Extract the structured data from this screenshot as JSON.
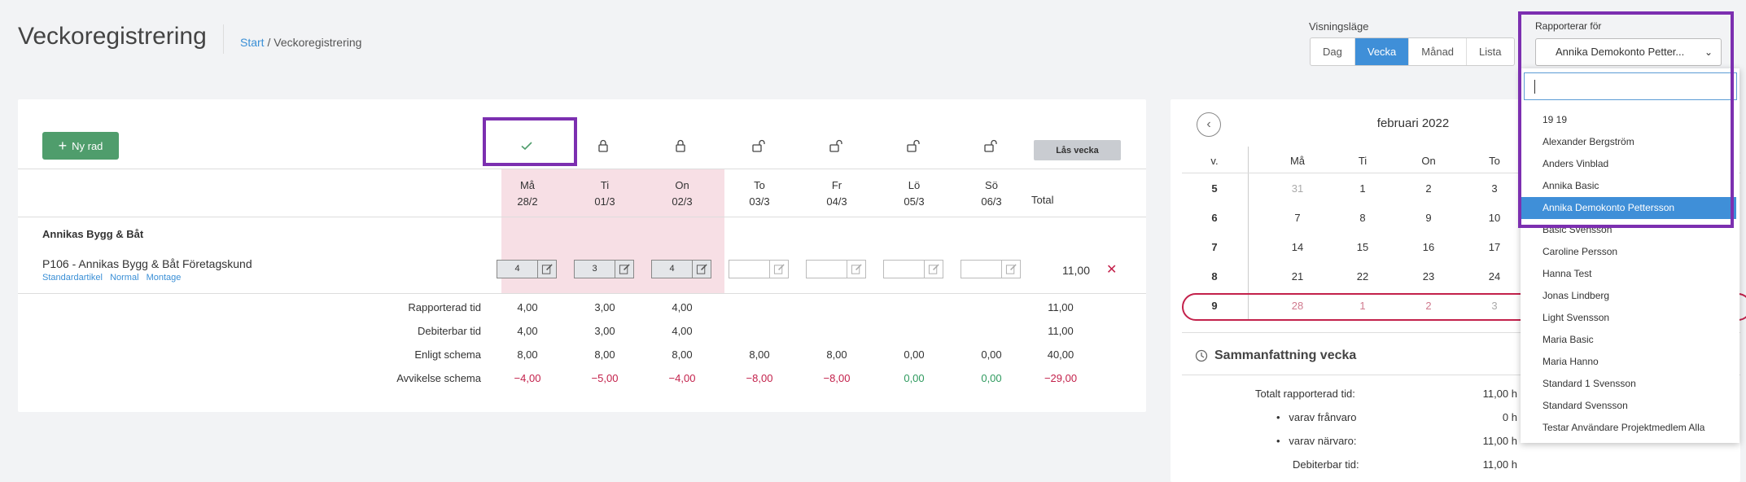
{
  "header": {
    "title": "Veckoregistrering",
    "breadcrumb_start": "Start",
    "breadcrumb_sep": "/",
    "breadcrumb_current": "Veckoregistrering"
  },
  "view": {
    "label": "Visningsläge",
    "options": [
      "Dag",
      "Vecka",
      "Månad",
      "Lista"
    ],
    "active": "Vecka"
  },
  "week": {
    "new_row_label": "Ny rad",
    "lock_week_label": "Lås vecka",
    "days": [
      {
        "name": "Må",
        "date": "28/2"
      },
      {
        "name": "Ti",
        "date": "01/3"
      },
      {
        "name": "On",
        "date": "02/3"
      },
      {
        "name": "To",
        "date": "03/3"
      },
      {
        "name": "Fr",
        "date": "04/3"
      },
      {
        "name": "Lö",
        "date": "05/3"
      },
      {
        "name": "Sö",
        "date": "06/3"
      }
    ],
    "total_label": "Total",
    "customer": "Annikas Bygg & Båt",
    "project": "P106 - Annikas Bygg & Båt Företagskund",
    "tags": [
      "Standardartikel",
      "Normal",
      "Montage"
    ],
    "hours": [
      "4",
      "3",
      "4",
      "",
      "",
      "",
      ""
    ],
    "row_total": "11,00",
    "delete_symbol": "✕",
    "summary_rows": [
      {
        "label": "Rapporterad tid",
        "values": [
          "4,00",
          "3,00",
          "4,00",
          "",
          "",
          "",
          ""
        ],
        "total": "11,00"
      },
      {
        "label": "Debiterbar tid",
        "values": [
          "4,00",
          "3,00",
          "4,00",
          "",
          "",
          "",
          ""
        ],
        "total": "11,00"
      },
      {
        "label": "Enligt schema",
        "values": [
          "8,00",
          "8,00",
          "8,00",
          "8,00",
          "8,00",
          "0,00",
          "0,00"
        ],
        "total": "40,00"
      },
      {
        "label": "Avvikelse schema",
        "values": [
          "−4,00",
          "−5,00",
          "−4,00",
          "−8,00",
          "−8,00",
          "0,00",
          "0,00"
        ],
        "total": "−29,00"
      }
    ]
  },
  "calendar": {
    "prev_symbol": "‹",
    "month": "februari 2022",
    "week_header": "v.",
    "day_headers": [
      "Må",
      "Ti",
      "On",
      "To"
    ],
    "rows": [
      {
        "week": "5",
        "days": [
          "31",
          "1",
          "2",
          "3"
        ]
      },
      {
        "week": "6",
        "days": [
          "7",
          "8",
          "9",
          "10"
        ]
      },
      {
        "week": "7",
        "days": [
          "14",
          "15",
          "16",
          "17"
        ]
      },
      {
        "week": "8",
        "days": [
          "21",
          "22",
          "23",
          "24"
        ]
      },
      {
        "week": "9",
        "days": [
          "28",
          "1",
          "2",
          "3"
        ]
      }
    ]
  },
  "summary": {
    "title": "Sammanfattning vecka",
    "rows": [
      {
        "label": "Totalt rapporterad tid:",
        "value": "11,00 h"
      },
      {
        "label": "varav frånvaro",
        "value": "0 h"
      },
      {
        "label": "varav närvaro:",
        "value": "11,00 h"
      },
      {
        "label": "Debiterbar tid:",
        "value": "11,00 h"
      }
    ]
  },
  "reporter": {
    "label": "Rapporterar för",
    "selected": "Annika Demokonto Petter...",
    "options": [
      "19 19",
      "Alexander Bergström",
      "Anders Vinblad",
      "Annika Basic",
      "Annika Demokonto Pettersson",
      "Basic Svensson",
      "Caroline Persson",
      "Hanna Test",
      "Jonas Lindberg",
      "Light Svensson",
      "Maria Basic",
      "Maria Hanno",
      "Standard 1 Svensson",
      "Standard Svensson",
      "Testar Användare Projektmedlem Alla"
    ],
    "active_option": "Annika Demokonto Pettersson"
  },
  "colors": {
    "accent": "#3f8fd8",
    "primary_button": "#4f9d6c",
    "highlight_outline": "#7c2fb0",
    "negative": "#c3214b",
    "positive": "#2e9a5e",
    "locked_day_bg": "#f7dfe5"
  }
}
